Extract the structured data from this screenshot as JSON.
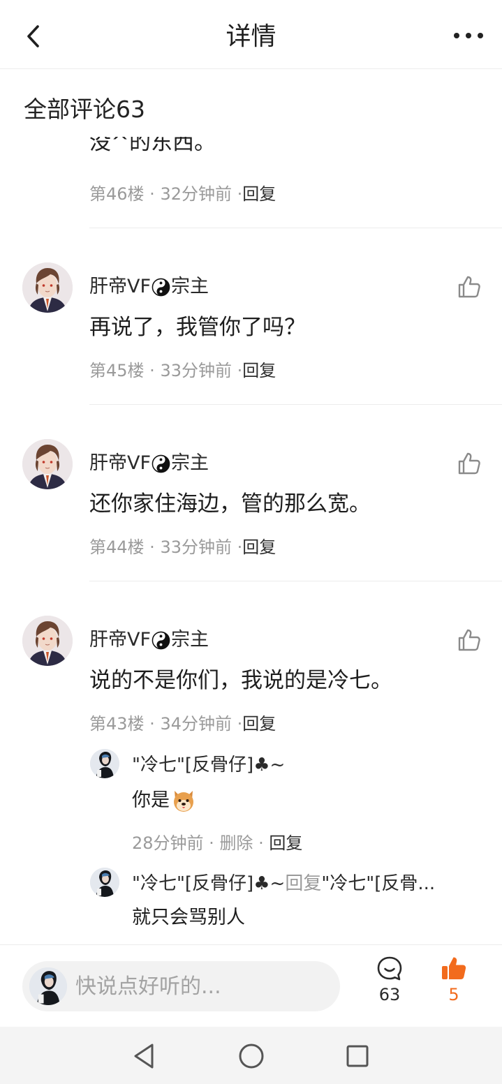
{
  "header": {
    "title": "详情"
  },
  "comments_header": "全部评论63",
  "partial_comment": {
    "text": "没^的东西。",
    "floor": "第46楼",
    "time": "32分钟前",
    "reply_label": "回复"
  },
  "comments": [
    {
      "author_prefix": "肝帝VF",
      "author_suffix": "宗主",
      "text": "再说了，我管你了吗？",
      "floor": "第45楼",
      "time": "33分钟前",
      "reply_label": "回复"
    },
    {
      "author_prefix": "肝帝VF",
      "author_suffix": "宗主",
      "text": "还你家住海边，管的那么宽。",
      "floor": "第44楼",
      "time": "33分钟前",
      "reply_label": "回复"
    },
    {
      "author_prefix": "肝帝VF",
      "author_suffix": "宗主",
      "text": "说的不是你们，我说的是冷七。",
      "floor": "第43楼",
      "time": "34分钟前",
      "reply_label": "回复"
    }
  ],
  "replies": [
    {
      "author": "\"冷七\"[反骨仔]♣~",
      "text": "你是",
      "emoji": "dog-emoji",
      "time": "28分钟前",
      "delete_label": "删除",
      "reply_label": "回复"
    },
    {
      "author": "\"冷七\"[反骨仔]♣~",
      "reply_word": "回复",
      "target": "\"冷七\"[反骨...",
      "text": "就只会骂别人"
    }
  ],
  "composer": {
    "placeholder": "快说点好听的...",
    "comment_count": "63",
    "like_count": "5"
  },
  "colors": {
    "accent": "#f26b1d",
    "muted_text": "#9a9a9a",
    "divider": "#ececec"
  },
  "icons": [
    "back-icon",
    "more-icon",
    "thumbs-up-icon",
    "comment-icon",
    "yin-yang-icon",
    "nav-back-icon",
    "nav-home-icon",
    "nav-recents-icon"
  ]
}
